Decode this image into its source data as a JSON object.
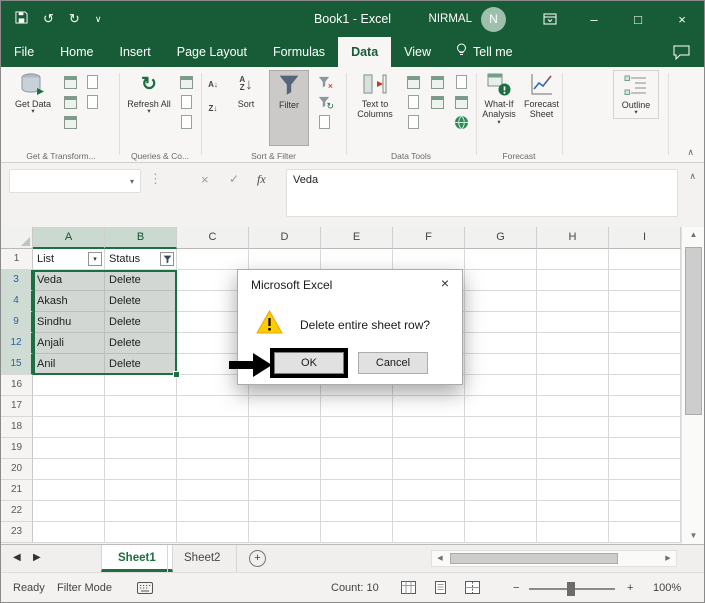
{
  "glyphs": {
    "undo": "↺",
    "redo": "↻",
    "refresh": "↻",
    "qat_caret": "∨",
    "caret": "▾",
    "minimize": "–",
    "maximize": "□",
    "close": "×",
    "divider_dots": "⋮",
    "cancel_x": "×",
    "check": "✓",
    "fx": "fx",
    "collapse_up": "∧",
    "dropdown": "▾",
    "scroll_up": "▲",
    "scroll_down": "▼",
    "scroll_left": "◀",
    "scroll_right": "▶",
    "nav_left": "◀",
    "nav_right": "▶",
    "add_sheet": "+",
    "zoom_minus": "−",
    "zoom_plus": "+",
    "letter_a": "A",
    "letter_z": "Z",
    "arrow_down": "↓",
    "sort_asc": "A↓",
    "sort_desc": "Z↓"
  },
  "titlebar": {
    "title": "Book1 - Excel",
    "user": "NIRMAL",
    "avatar_initial": "N"
  },
  "tabs": [
    {
      "label": "File"
    },
    {
      "label": "Home"
    },
    {
      "label": "Insert"
    },
    {
      "label": "Page Layout"
    },
    {
      "label": "Formulas"
    },
    {
      "label": "Data"
    },
    {
      "label": "View"
    }
  ],
  "tellme_label": "Tell me",
  "ribbon": {
    "get_data": "Get Data",
    "group_transform": "Get & Transform...",
    "refresh_all": "Refresh All",
    "group_queries": "Queries & Co...",
    "sort": "Sort",
    "filter": "Filter",
    "group_sort": "Sort & Filter",
    "text_to_columns": "Text to Columns",
    "group_tools": "Data Tools",
    "what_if": "What-If Analysis",
    "forecast_sheet": "Forecast Sheet",
    "group_forecast": "Forecast",
    "outline": "Outline"
  },
  "formula_bar": {
    "name_box_value": "",
    "content": "Veda"
  },
  "sheet": {
    "columns": [
      "A",
      "B",
      "C",
      "D",
      "E",
      "F",
      "G",
      "H",
      "I"
    ],
    "rows": [
      {
        "num": "1",
        "a": "List",
        "b": "Status"
      },
      {
        "num": "3",
        "a": "Veda",
        "b": "Delete"
      },
      {
        "num": "4",
        "a": "Akash",
        "b": "Delete"
      },
      {
        "num": "9",
        "a": "Sindhu",
        "b": "Delete"
      },
      {
        "num": "12",
        "a": "Anjali",
        "b": "Delete"
      },
      {
        "num": "15",
        "a": "Anil",
        "b": "Delete"
      },
      {
        "num": "16"
      },
      {
        "num": "17"
      },
      {
        "num": "18"
      },
      {
        "num": "19"
      },
      {
        "num": "20"
      },
      {
        "num": "21"
      },
      {
        "num": "22"
      },
      {
        "num": "23"
      }
    ]
  },
  "dialog": {
    "title": "Microsoft Excel",
    "message": "Delete entire sheet row?",
    "ok": "OK",
    "cancel": "Cancel"
  },
  "sheet_tabs": {
    "sheet1": "Sheet1",
    "sheet2": "Sheet2"
  },
  "status_bar": {
    "ready": "Ready",
    "filter_mode": "Filter Mode",
    "count": "Count: 10",
    "zoom": "100%"
  }
}
